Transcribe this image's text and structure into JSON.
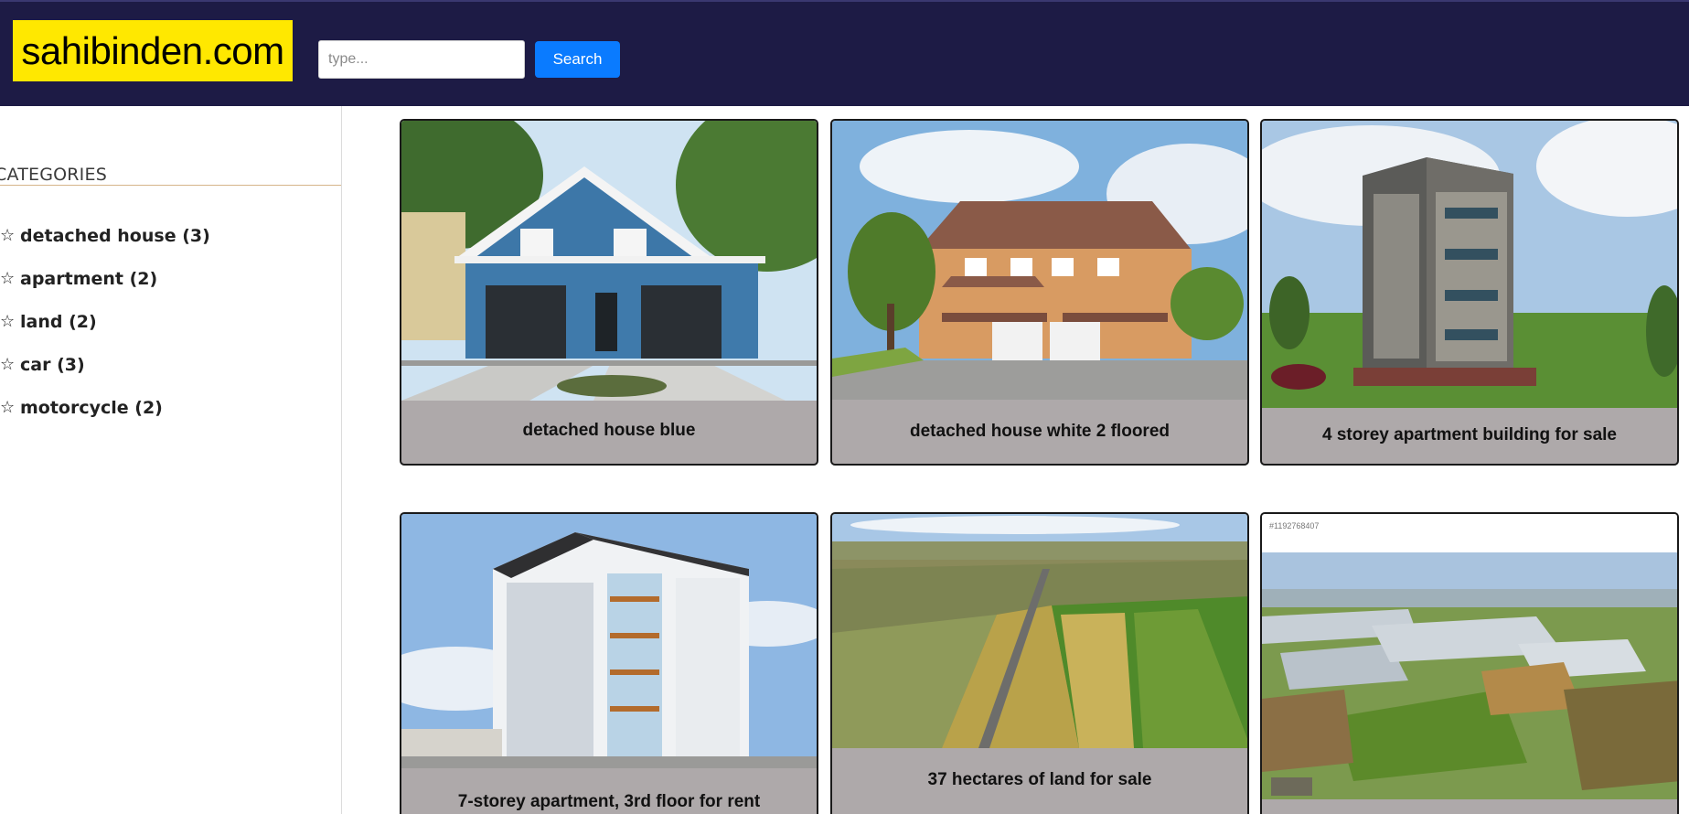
{
  "header": {
    "logo_text": "sahibinden.com",
    "search_placeholder": "type...",
    "search_button": "Search"
  },
  "sidebar": {
    "title": "CATEGORIES",
    "items": [
      {
        "label": "detached house (3)"
      },
      {
        "label": "apartment (2)"
      },
      {
        "label": "land (2)"
      },
      {
        "label": "car (3)"
      },
      {
        "label": "motorcycle (2)"
      }
    ],
    "star_glyph": "☆"
  },
  "listings": [
    {
      "title": "detached house blue"
    },
    {
      "title": "detached house white 2 floored"
    },
    {
      "title": "4 storey apartment building for sale"
    },
    {
      "title": "7-storey apartment, 3rd floor for rent"
    },
    {
      "title": "37 hectares of land for sale"
    },
    {
      "title": "",
      "stock_id": "#1192768407"
    }
  ],
  "colors": {
    "header_bg": "#1d1b45",
    "logo_bg": "#ffe800",
    "search_button_bg": "#0a7bff",
    "card_caption_bg": "#aea9aa"
  }
}
